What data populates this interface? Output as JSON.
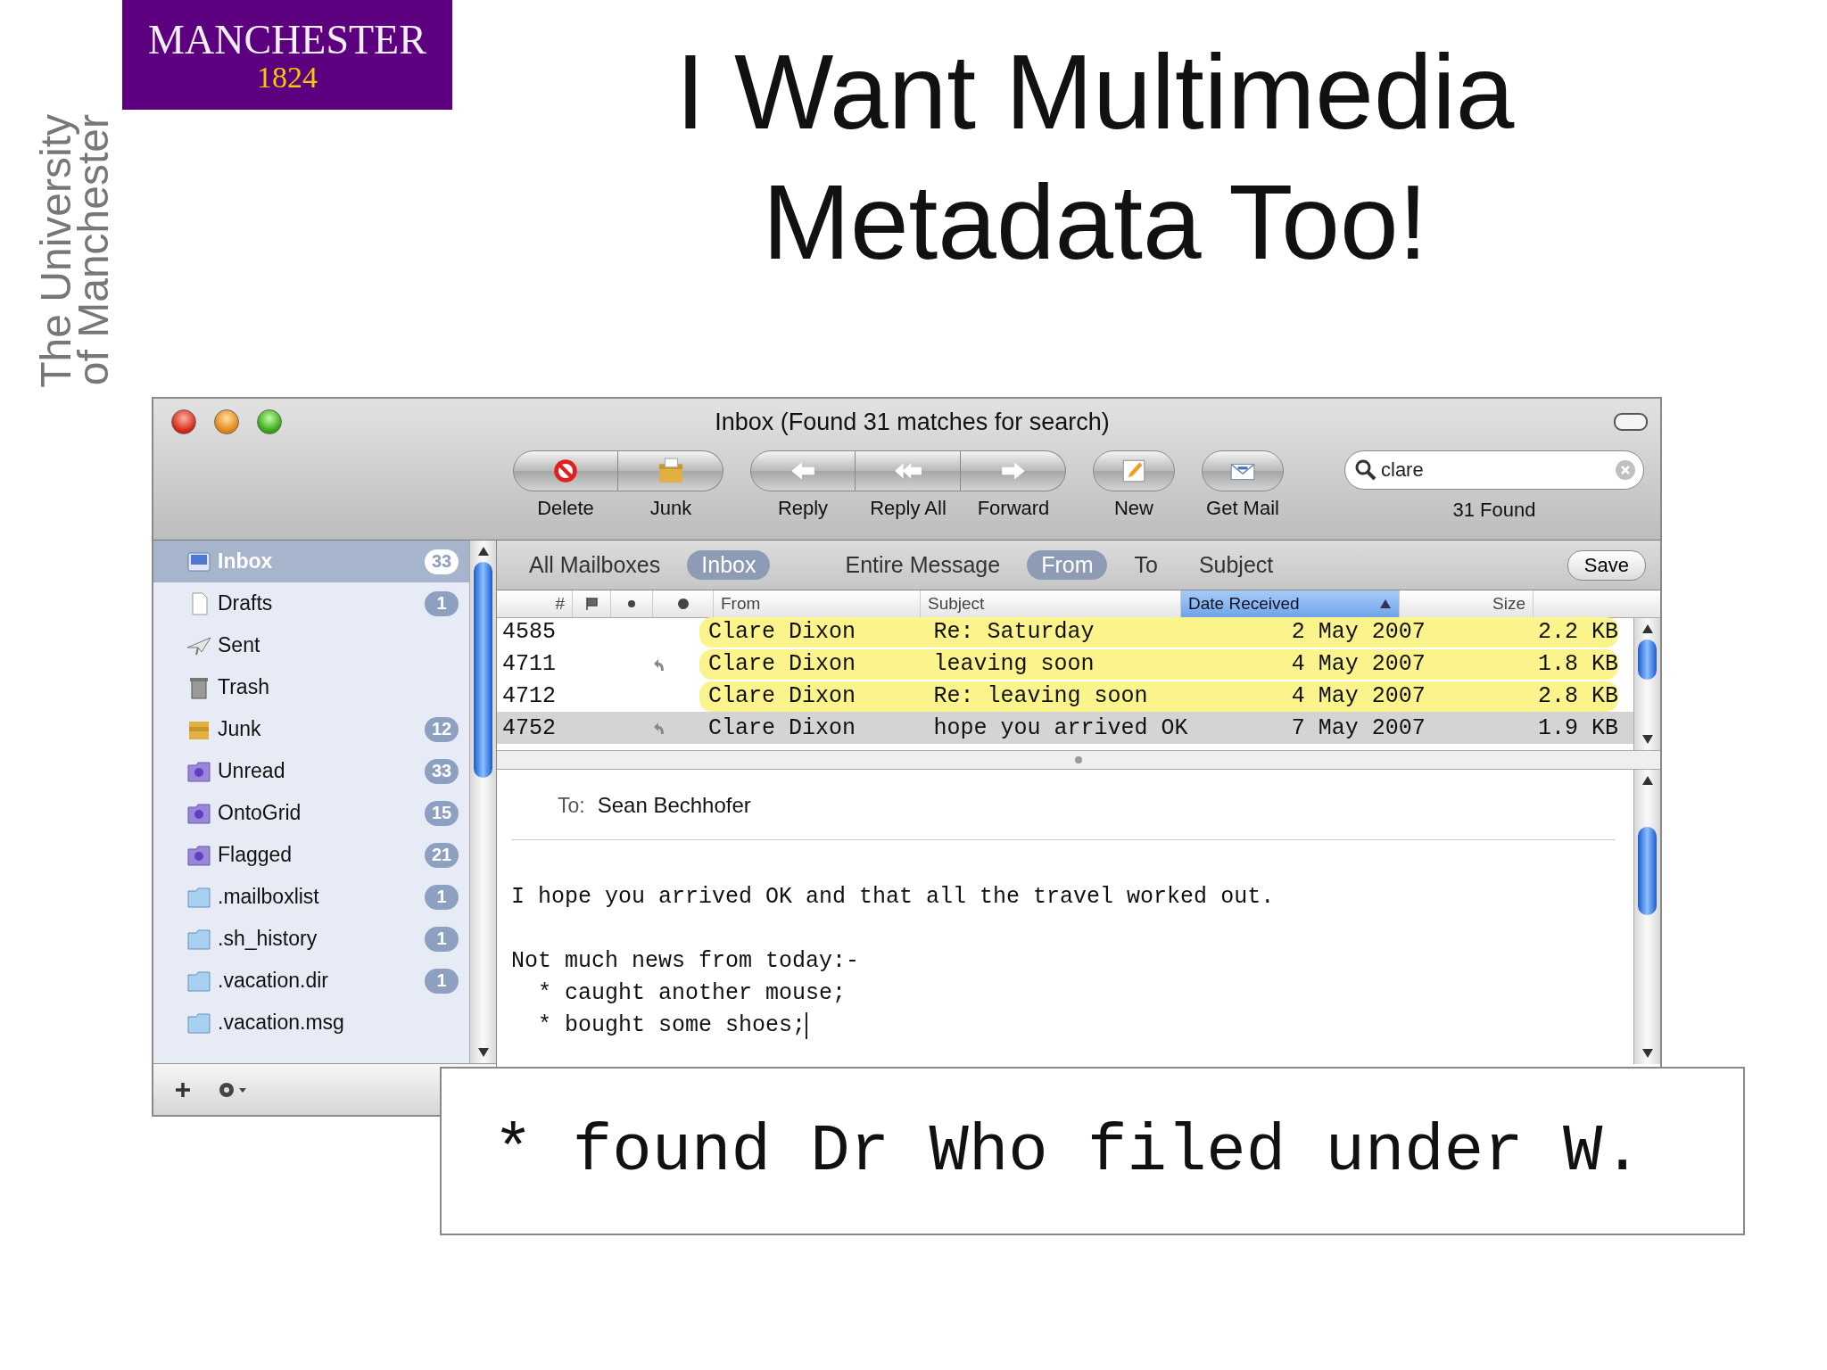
{
  "logo": {
    "name": "MANCHESTER",
    "year": "1824"
  },
  "side_text": [
    "The University",
    "of Manchester"
  ],
  "title_lines": [
    "I Want Multimedia",
    "Metadata Too!"
  ],
  "mail_window": {
    "title": "Inbox (Found 31 matches for search)",
    "toolbar_groups": [
      [
        {
          "kind": "delete",
          "label": "Delete"
        },
        {
          "kind": "junk",
          "label": "Junk"
        }
      ],
      [
        {
          "kind": "reply",
          "label": "Reply"
        },
        {
          "kind": "reply_all",
          "label": "Reply All"
        },
        {
          "kind": "forward",
          "label": "Forward"
        }
      ],
      [
        {
          "kind": "new",
          "label": "New"
        }
      ],
      [
        {
          "kind": "get_mail",
          "label": "Get Mail"
        }
      ]
    ],
    "search": {
      "value": "clare",
      "result": "31 Found"
    },
    "mailboxes": [
      {
        "kind": "inbox",
        "label": "Inbox",
        "count": "33",
        "selected": true
      },
      {
        "kind": "drafts",
        "label": "Drafts",
        "count": "1",
        "selected": false
      },
      {
        "kind": "sent",
        "label": "Sent",
        "selected": false
      },
      {
        "kind": "trash",
        "label": "Trash",
        "selected": false
      },
      {
        "kind": "junk",
        "label": "Junk",
        "count": "12",
        "selected": false
      },
      {
        "kind": "smart",
        "label": "Unread",
        "count": "33",
        "selected": false
      },
      {
        "kind": "smart",
        "label": "OntoGrid",
        "count": "15",
        "selected": false
      },
      {
        "kind": "smart",
        "label": "Flagged",
        "count": "21",
        "selected": false
      },
      {
        "kind": "folder",
        "label": ".mailboxlist",
        "count": "1",
        "selected": false
      },
      {
        "kind": "folder",
        "label": ".sh_history",
        "count": "1",
        "selected": false
      },
      {
        "kind": "folder",
        "label": ".vacation.dir",
        "count": "1",
        "selected": false
      },
      {
        "kind": "folder",
        "label": ".vacation.msg",
        "selected": false
      }
    ],
    "scope_mailboxes": [
      {
        "label": "All Mailboxes",
        "selected": false
      },
      {
        "label": "Inbox",
        "selected": true
      }
    ],
    "scope_fields": [
      {
        "label": "Entire Message",
        "selected": false
      },
      {
        "label": "From",
        "selected": true
      },
      {
        "label": "To",
        "selected": false
      },
      {
        "label": "Subject",
        "selected": false
      }
    ],
    "save_button": "Save",
    "columns": [
      {
        "kind": "number",
        "label": "#",
        "sorted": false
      },
      {
        "kind": "flag",
        "sorted": false
      },
      {
        "kind": "unread",
        "sorted": false
      },
      {
        "kind": "attachment",
        "sorted": false
      },
      {
        "kind": "from",
        "label": "From",
        "sorted": false
      },
      {
        "kind": "subject",
        "label": "Subject",
        "sorted": false
      },
      {
        "kind": "date",
        "label": "Date Received",
        "sorted": true
      },
      {
        "kind": "size",
        "label": "Size",
        "sorted": false
      }
    ],
    "messages": [
      {
        "number": "4585",
        "replied": false,
        "from": "Clare Dixon",
        "subject": "Re: Saturday",
        "date": "2 May 2007",
        "size": "2.2 KB",
        "match": true,
        "selected": false
      },
      {
        "number": "4711",
        "replied": true,
        "from": "Clare Dixon",
        "subject": "leaving soon",
        "date": "4 May 2007",
        "size": "1.8 KB",
        "match": true,
        "selected": false
      },
      {
        "number": "4712",
        "replied": false,
        "from": "Clare Dixon",
        "subject": "Re: leaving soon",
        "date": "4 May 2007",
        "size": "2.8 KB",
        "match": true,
        "selected": false
      },
      {
        "number": "4752",
        "replied": true,
        "from": "Clare Dixon",
        "subject": "hope you arrived OK",
        "date": "7 May 2007",
        "size": "1.9 KB",
        "match": false,
        "selected": true
      }
    ],
    "preview": {
      "to_label": "To:",
      "to": "Sean Bechhofer",
      "paragraphs": [
        [
          "I hope you arrived OK and that all the travel worked out."
        ],
        [
          "Not much news from today:-",
          "  * caught another mouse;",
          "  * bought some shoes;"
        ]
      ],
      "cursor": true
    }
  },
  "magnifier": {
    "line": "* found Dr Who filed under W."
  }
}
